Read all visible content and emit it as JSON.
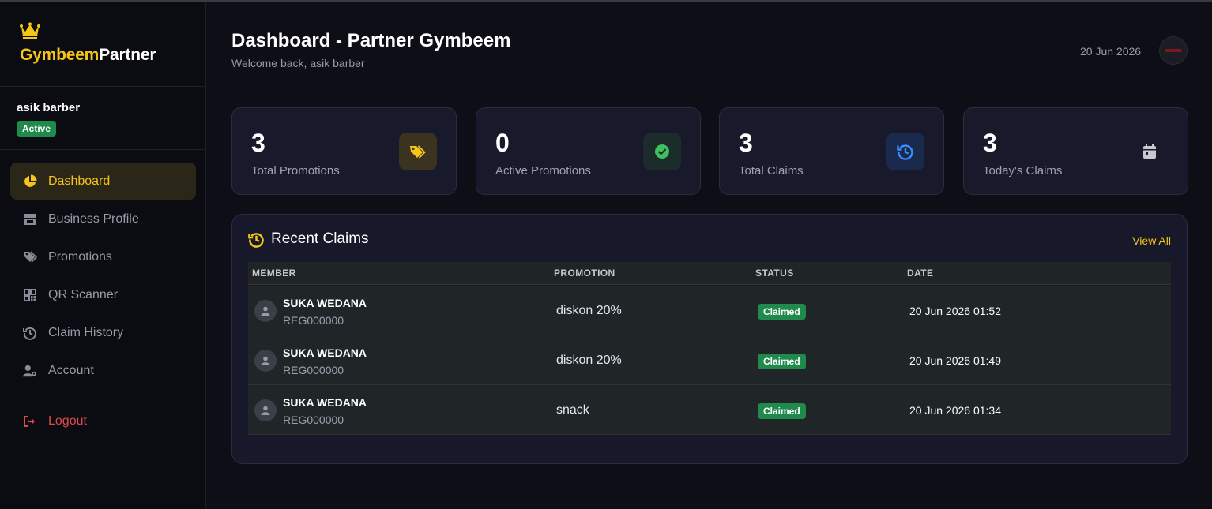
{
  "sidebar": {
    "brand_primary": "Gymbeem",
    "brand_secondary": "Partner",
    "user_name": "asik barber",
    "user_status": "Active",
    "nav": [
      {
        "label": "Dashboard",
        "icon": "chart-pie-icon",
        "active": true
      },
      {
        "label": "Business Profile",
        "icon": "store-icon"
      },
      {
        "label": "Promotions",
        "icon": "tags-icon"
      },
      {
        "label": "QR Scanner",
        "icon": "qrcode-icon"
      },
      {
        "label": "Claim History",
        "icon": "history-icon"
      },
      {
        "label": "Account",
        "icon": "user-gear-icon"
      }
    ],
    "logout_label": "Logout"
  },
  "header": {
    "title": "Dashboard - Partner Gymbeem",
    "subtitle": "Welcome back, asik barber",
    "date": "20 Jun 2026"
  },
  "stats": [
    {
      "value": "3",
      "label": "Total Promotions",
      "icon": "tags-icon",
      "color": "#f5c518"
    },
    {
      "value": "0",
      "label": "Active Promotions",
      "icon": "check-circle-icon",
      "color": "#3fbf5f"
    },
    {
      "value": "3",
      "label": "Total Claims",
      "icon": "history-icon",
      "color": "#3b8cff"
    },
    {
      "value": "3",
      "label": "Today's Claims",
      "icon": "calendar-icon",
      "color": "#c8c8d0"
    }
  ],
  "recent_claims": {
    "title": "Recent Claims",
    "view_all": "View All",
    "columns": [
      "MEMBER",
      "PROMOTION",
      "STATUS",
      "DATE"
    ],
    "rows": [
      {
        "name": "SUKA WEDANA",
        "id": "REG000000",
        "promotion": "diskon 20%",
        "status": "Claimed",
        "date": "20 Jun 2026 01:52"
      },
      {
        "name": "SUKA WEDANA",
        "id": "REG000000",
        "promotion": "diskon 20%",
        "status": "Claimed",
        "date": "20 Jun 2026 01:49"
      },
      {
        "name": "SUKA WEDANA",
        "id": "REG000000",
        "promotion": "snack",
        "status": "Claimed",
        "date": "20 Jun 2026 01:34"
      }
    ]
  },
  "colors": {
    "accent": "#f5c518",
    "success": "#1f8a4c",
    "danger": "#e04a4a"
  }
}
